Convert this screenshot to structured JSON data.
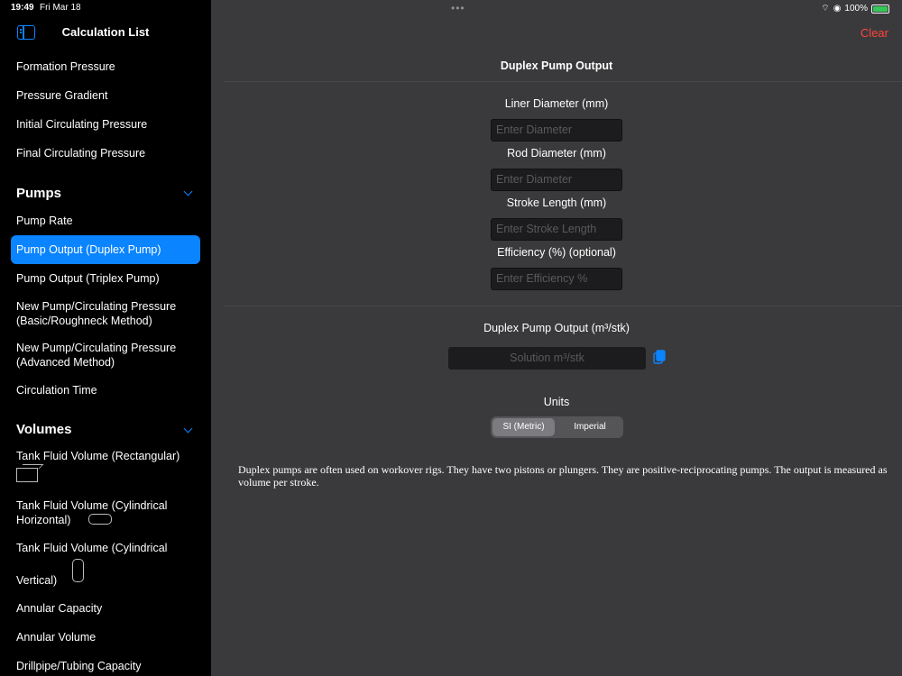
{
  "status": {
    "time": "19:49",
    "date": "Fri Mar 18",
    "battery": "100%"
  },
  "sidebar": {
    "title": "Calculation List",
    "items_top": [
      "Formation Pressure",
      "Pressure Gradient",
      "Initial Circulating Pressure",
      "Final Circulating Pressure"
    ],
    "pumps": {
      "section": "Pumps",
      "items": [
        "Pump Rate",
        "Pump Output (Duplex Pump)",
        "Pump Output (Triplex Pump)",
        "New Pump/Circulating Pressure",
        "(Basic/Roughneck Method)",
        "New Pump/Circulating Pressure",
        "(Advanced Method)",
        "Circulation Time"
      ]
    },
    "volumes": {
      "section": "Volumes",
      "items": [
        "Tank Fluid Volume (Rectangular)",
        "Tank Fluid Volume (Cylindrical",
        "Horizontal)",
        "Tank Fluid Volume (Cylindrical",
        "Vertical)",
        "Annular Capacity",
        "Annular Volume",
        "Drillpipe/Tubing Capacity"
      ]
    }
  },
  "main": {
    "clear_label": "Clear",
    "title": "Duplex Pump Output",
    "fields": [
      {
        "label": "Liner Diameter (mm)",
        "placeholder": "Enter Diameter"
      },
      {
        "label": "Rod Diameter (mm)",
        "placeholder": "Enter Diameter"
      },
      {
        "label": "Stroke Length (mm)",
        "placeholder": "Enter Stroke Length"
      },
      {
        "label": "Efficiency (%) (optional)",
        "placeholder": "Enter Efficiency %"
      }
    ],
    "output_label": "Duplex Pump Output (m³/stk)",
    "output_placeholder": "Solution m³/stk",
    "units_label": "Units",
    "units_options": [
      "SI (Metric)",
      "Imperial"
    ],
    "description": "Duplex pumps are often used on workover rigs. They have two pistons or plungers. They are positive-reciprocating pumps. The output is measured as volume per stroke."
  },
  "colors": {
    "accent": "#0a84ff",
    "clear": "#ff453a",
    "selected": "#0a84ff"
  }
}
